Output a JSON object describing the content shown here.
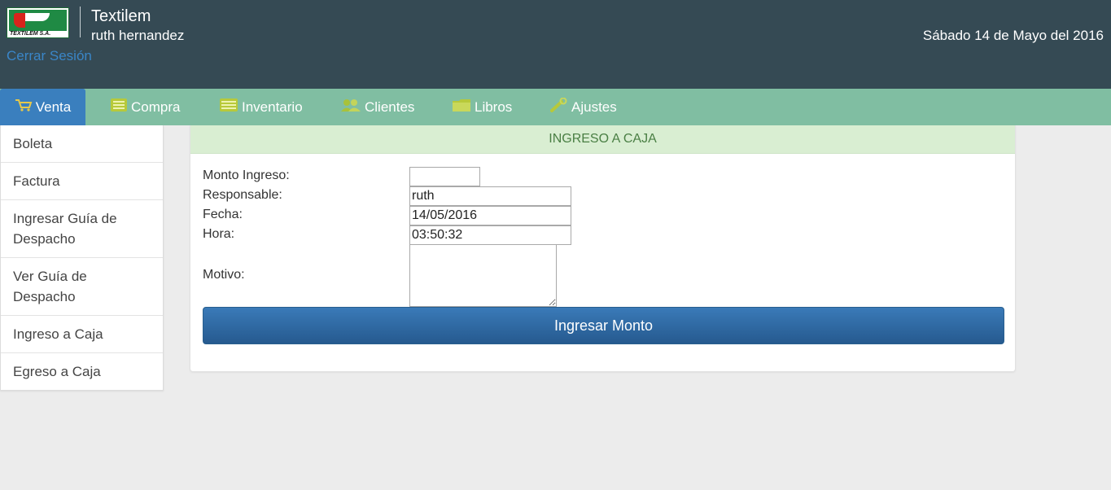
{
  "header": {
    "app_title": "Textilem",
    "logo_text": "TEXTILEM S.A.",
    "user_name": "ruth hernandez",
    "logout_label": "Cerrar Sesión",
    "date": "Sábado 14 de Mayo del 2016"
  },
  "nav": {
    "items": [
      {
        "label": "Venta",
        "icon": "cart-icon",
        "active": true
      },
      {
        "label": "Compra",
        "icon": "list-icon"
      },
      {
        "label": "Inventario",
        "icon": "list-icon"
      },
      {
        "label": "Clientes",
        "icon": "users-icon"
      },
      {
        "label": "Libros",
        "icon": "folder-icon"
      },
      {
        "label": "Ajustes",
        "icon": "wrench-icon"
      }
    ]
  },
  "sidebar": {
    "items": [
      {
        "label": "Boleta"
      },
      {
        "label": "Factura"
      },
      {
        "label": "Ingresar Guía de Despacho"
      },
      {
        "label": "Ver Guía de Despacho"
      },
      {
        "label": "Ingreso a Caja"
      },
      {
        "label": "Egreso a Caja"
      }
    ]
  },
  "form": {
    "title": "INGRESO A CAJA",
    "monto_label": "Monto Ingreso:",
    "monto_value": "",
    "responsable_label": "Responsable:",
    "responsable_value": "ruth",
    "fecha_label": "Fecha:",
    "fecha_value": "14/05/2016",
    "hora_label": "Hora:",
    "hora_value": "03:50:32",
    "motivo_label": "Motivo:",
    "motivo_value": "",
    "submit_label": "Ingresar Monto"
  },
  "colors": {
    "header_bg": "#354a54",
    "nav_bg": "#80bea2",
    "nav_active": "#3a7fbe",
    "panel_head_bg": "#d9eed2",
    "button": "#2f6ba5",
    "link": "#3a86c8"
  }
}
